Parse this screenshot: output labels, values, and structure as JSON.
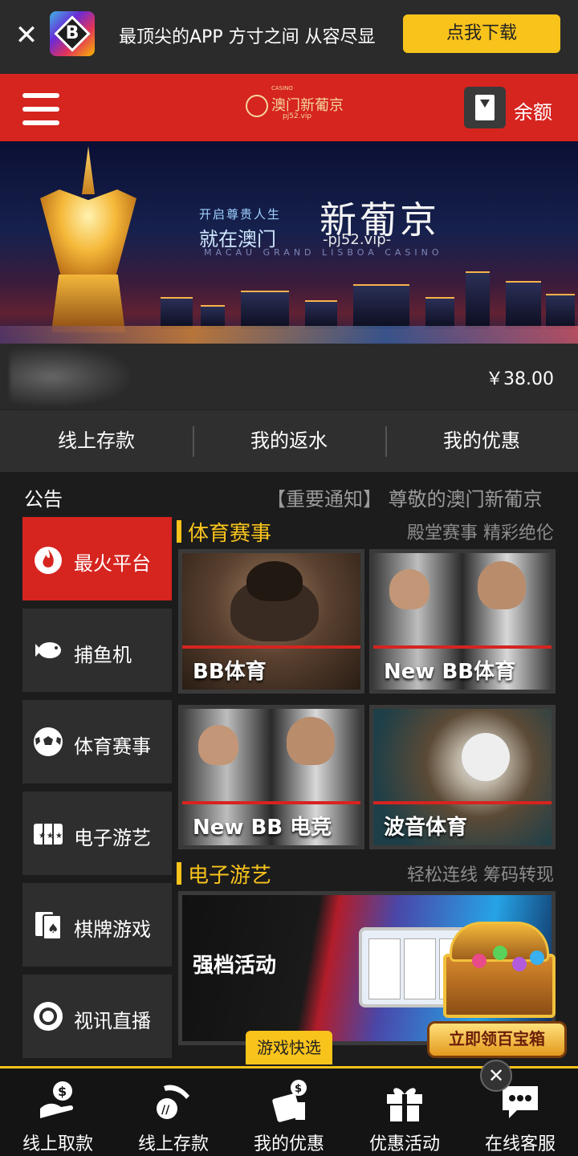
{
  "download_bar": {
    "tagline": "最顶尖的APP 方寸之间 从容尽显",
    "button": "点我下载",
    "logo_letter": "B"
  },
  "header": {
    "brand_name": "澳门新葡京",
    "brand_small": "CASINO",
    "brand_url": "pj52.vip",
    "balance_label": "余额"
  },
  "banner": {
    "kicker": "开启尊贵人生",
    "subtitle": "就在澳门",
    "title": "新葡京",
    "url": "-pj52.vip-",
    "english": "MACAU GRAND LISBOA CASINO"
  },
  "user": {
    "amount": "￥38.00"
  },
  "quick_actions": [
    "线上存款",
    "我的返水",
    "我的优惠"
  ],
  "notice": {
    "label": "公告",
    "text": "【重要通知】 尊敬的澳门新葡京"
  },
  "side_nav": [
    {
      "label": "最火平台",
      "icon": "fire-icon",
      "active": true
    },
    {
      "label": "捕鱼机",
      "icon": "fish-icon",
      "active": false
    },
    {
      "label": "体育赛事",
      "icon": "soccer-ball-icon",
      "active": false
    },
    {
      "label": "电子游艺",
      "icon": "slot-machine-icon",
      "active": false
    },
    {
      "label": "棋牌游戏",
      "icon": "cards-icon",
      "active": false
    },
    {
      "label": "视讯直播",
      "icon": "casino-chip-icon",
      "active": false
    }
  ],
  "sports_section": {
    "title": "体育赛事",
    "tags": "殿堂赛事  精彩绝伦",
    "cards": [
      "BB体育",
      "New BB体育",
      "New BB 电竞",
      "波音体育"
    ]
  },
  "slots_section": {
    "title": "电子游艺",
    "tags": "轻松连线  筹码转现",
    "promo_label": "强档活动"
  },
  "treasure": {
    "button": "立即领百宝箱"
  },
  "game_quick_label": "游戏快选",
  "bottom_nav": [
    {
      "label": "线上取款",
      "icon": "withdraw-icon"
    },
    {
      "label": "线上存款",
      "icon": "deposit-icon"
    },
    {
      "label": "我的优惠",
      "icon": "coupon-icon"
    },
    {
      "label": "优惠活动",
      "icon": "gift-icon"
    },
    {
      "label": "在线客服",
      "icon": "chat-icon"
    }
  ],
  "colors": {
    "brand_red": "#d6241f",
    "accent_yellow": "#f8c31b",
    "background": "#1c1c1c"
  }
}
